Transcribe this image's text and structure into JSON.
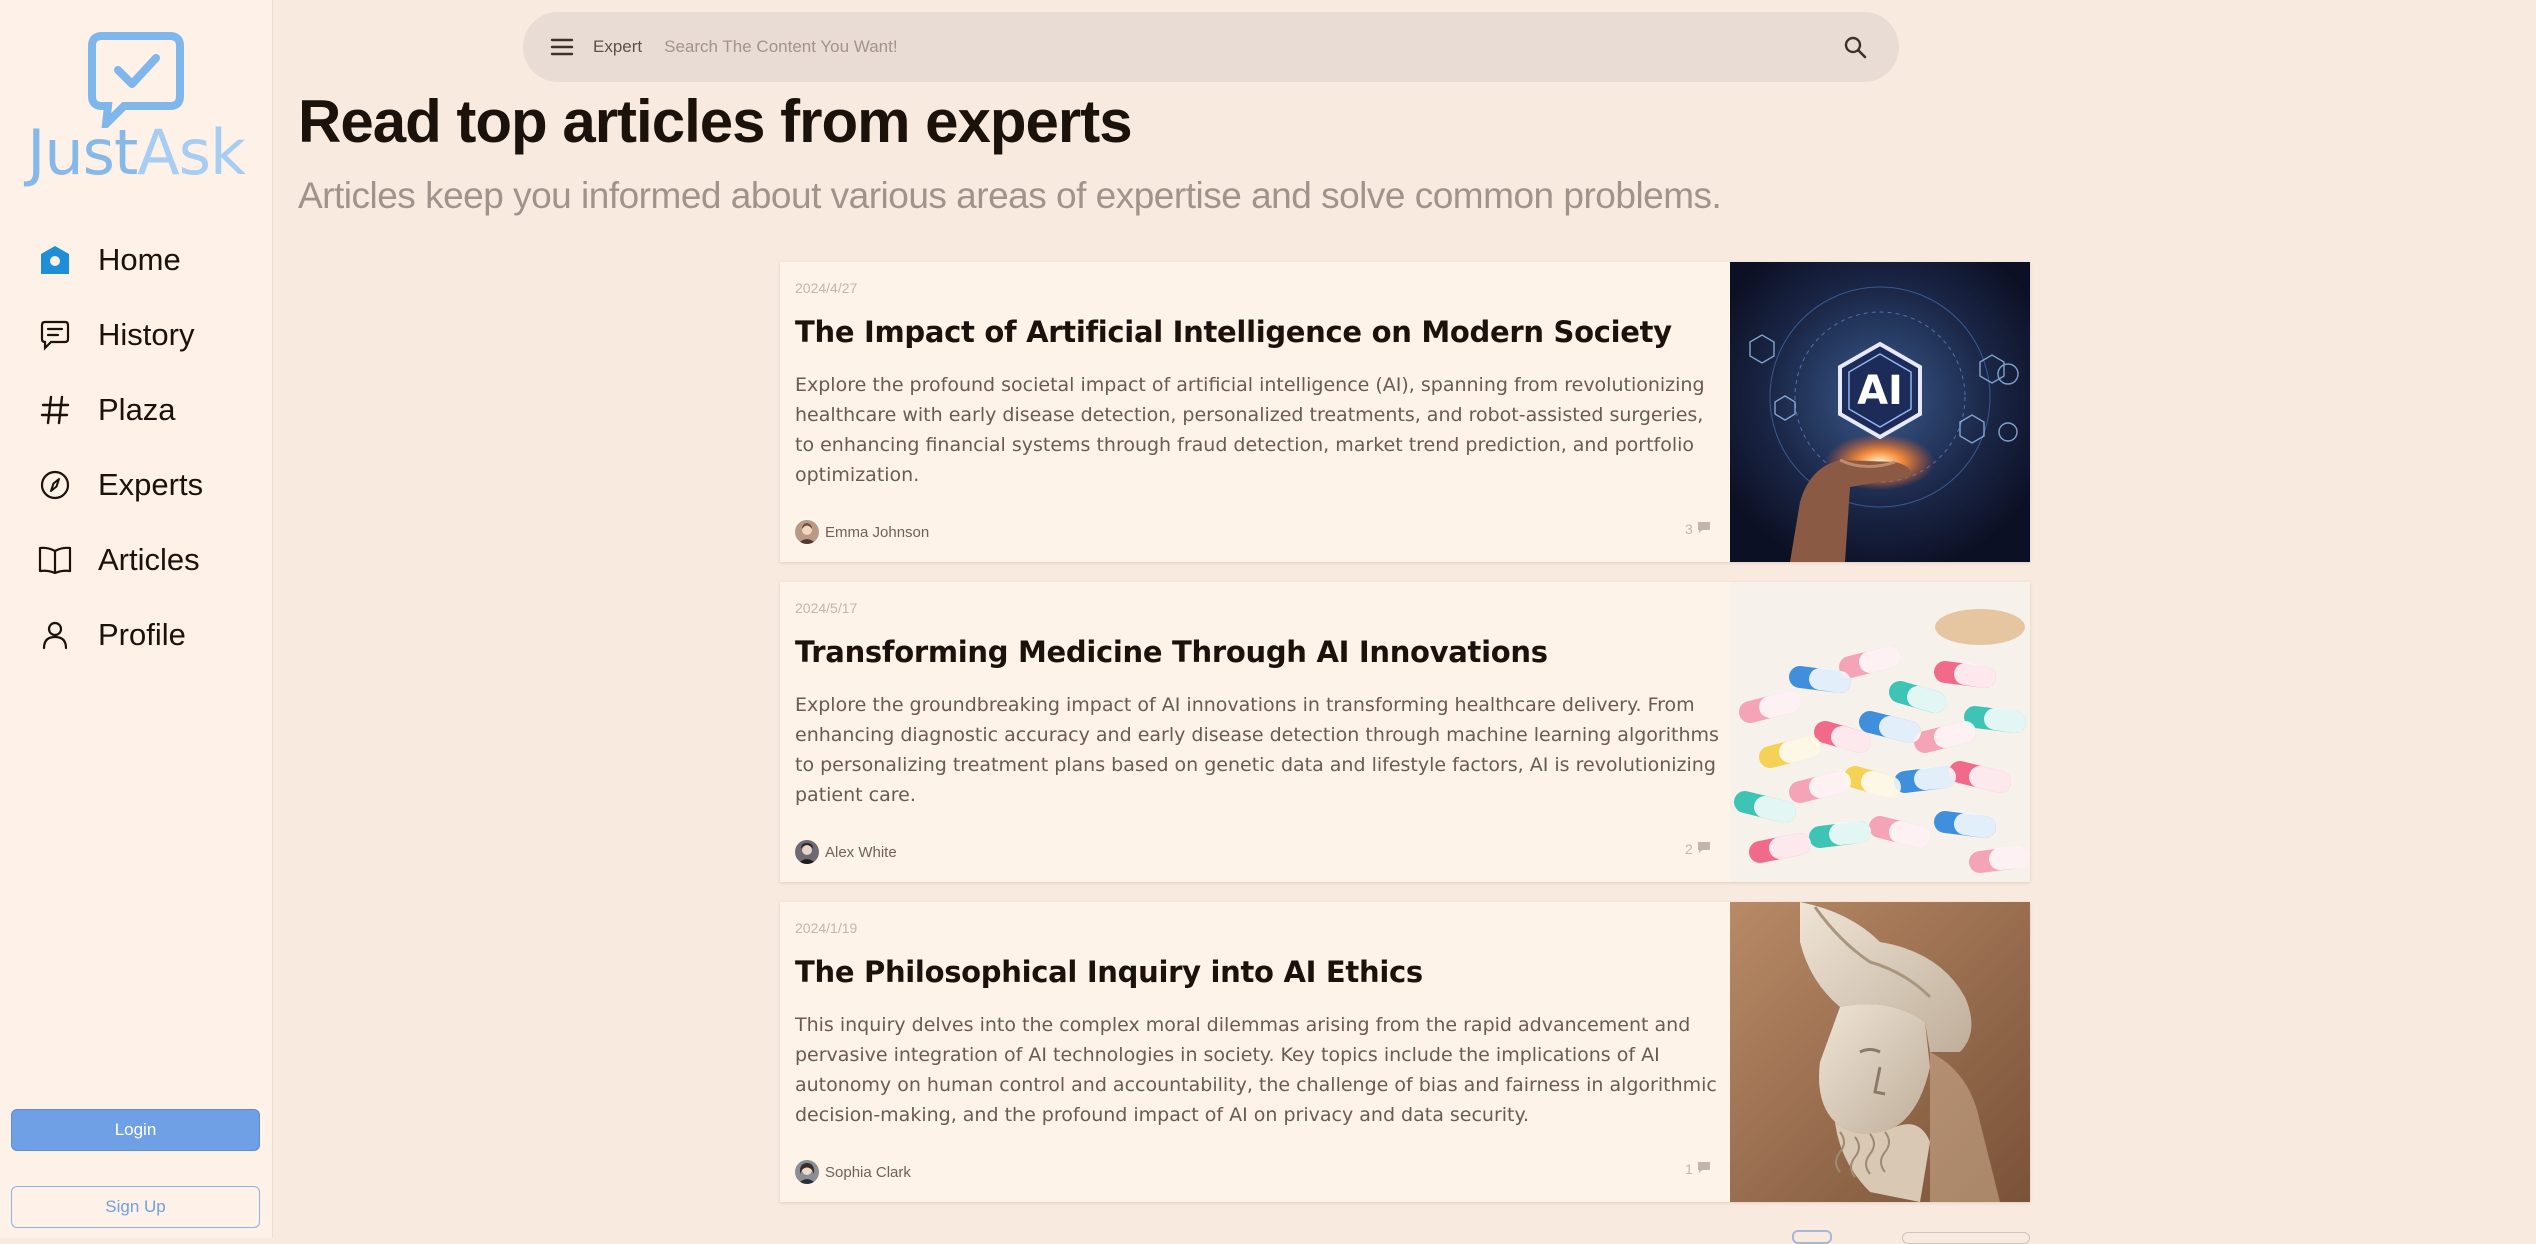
{
  "brand": {
    "part1": "Just",
    "part2": "Ask"
  },
  "sidebar": {
    "items": [
      {
        "label": "Home",
        "icon": "home-icon"
      },
      {
        "label": "History",
        "icon": "chat-history-icon"
      },
      {
        "label": "Plaza",
        "icon": "hash-icon"
      },
      {
        "label": "Experts",
        "icon": "compass-icon"
      },
      {
        "label": "Articles",
        "icon": "book-icon"
      },
      {
        "label": "Profile",
        "icon": "user-icon"
      }
    ],
    "login_label": "Login",
    "signup_label": "Sign Up"
  },
  "search": {
    "scope": "Expert",
    "placeholder": "Search The Content You Want!"
  },
  "page": {
    "title": "Read top articles from experts",
    "subtitle": "Articles keep you informed about various areas of expertise and solve common problems."
  },
  "articles": [
    {
      "date": "2024/4/27",
      "title": "The Impact of Artificial Intelligence on Modern Society",
      "summary": "Explore the profound societal impact of artificial intelligence (AI), spanning from revolutionizing healthcare with early disease detection, personalized treatments, and robot-assisted surgeries, to enhancing financial systems through fraud detection, market trend prediction, and portfolio optimization.",
      "author": "Emma Johnson",
      "comments": "3",
      "image": "ai-hand-image",
      "image_label": "AI"
    },
    {
      "date": "2024/5/17",
      "title": "Transforming Medicine Through AI Innovations",
      "summary": "Explore the groundbreaking impact of AI innovations in transforming healthcare delivery. From enhancing diagnostic accuracy and early disease detection through machine learning algorithms to personalizing treatment plans based on genetic data and lifestyle factors, AI is revolutionizing patient care.",
      "author": "Alex White",
      "comments": "2",
      "image": "pills-image"
    },
    {
      "date": "2024/1/19",
      "title": "The Philosophical Inquiry into AI Ethics",
      "summary": "This inquiry delves into the complex moral dilemmas arising from the rapid advancement and pervasive integration of AI technologies in society. Key topics include the implications of AI autonomy on human control and accountability, the challenge of bias and fairness in algorithmic decision-making, and the profound impact of AI on privacy and data security.",
      "author": "Sophia Clark",
      "comments": "1",
      "image": "statue-image"
    }
  ],
  "colors": {
    "accent": "#6f9fe4",
    "home_icon": "#1e8fd6",
    "background": "#f8eadf",
    "sidebar": "#fdf1e8"
  }
}
